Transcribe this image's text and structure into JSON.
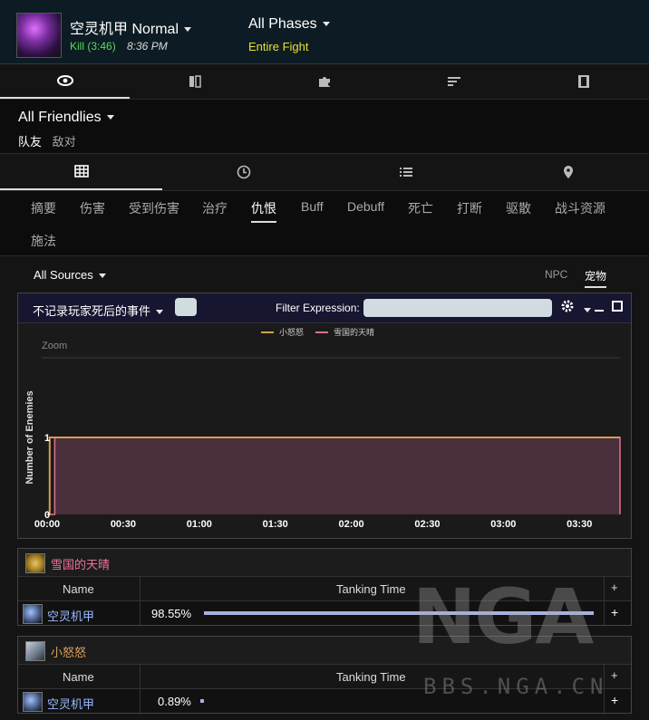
{
  "header": {
    "encounter": "空灵机甲 Normal",
    "kill_text": "Kill (3:46)",
    "time": "8:36 PM",
    "phase": "All Phases",
    "phase_sub": "Entire Fight"
  },
  "top_tabs": [
    {
      "name": "eye-icon"
    },
    {
      "name": "compare-icon"
    },
    {
      "name": "puzzle-icon"
    },
    {
      "name": "sort-icon"
    },
    {
      "name": "film-icon"
    }
  ],
  "friendlies": {
    "select": "All Friendlies",
    "links": [
      "队友",
      "敌对"
    ]
  },
  "sub_tabs": [
    {
      "name": "table-icon"
    },
    {
      "name": "clock-icon"
    },
    {
      "name": "list-icon"
    },
    {
      "name": "map-pin-icon"
    }
  ],
  "view_tabs": [
    "摘要",
    "伤害",
    "受到伤害",
    "治疗",
    "仇恨",
    "Buff",
    "Debuff",
    "死亡",
    "打断",
    "驱散",
    "战斗资源",
    "施法"
  ],
  "active_view_tab": "仇恨",
  "sources": {
    "select": "All Sources",
    "npc": "NPC",
    "pet": "宠物"
  },
  "chart_toolbar": {
    "death_filter": "不记录玩家死后的事件",
    "filter_label": "Filter Expression:"
  },
  "chart_data": {
    "type": "area",
    "ylabel": "Number of Enemies",
    "zoom_label": "Zoom",
    "x_ticks": [
      "00:00",
      "00:30",
      "01:00",
      "01:30",
      "02:00",
      "02:30",
      "03:00",
      "03:30"
    ],
    "y_ticks": [
      "0",
      "1"
    ],
    "ylim": [
      0,
      1
    ],
    "xlim_seconds": [
      0,
      226
    ],
    "series": [
      {
        "name": "小怒怒",
        "color": "#d4a050",
        "points": [
          [
            0,
            0
          ],
          [
            1,
            0
          ],
          [
            1,
            1
          ],
          [
            226,
            1
          ]
        ]
      },
      {
        "name": "雪国的天晴",
        "color": "#e07090",
        "points": [
          [
            0,
            0
          ],
          [
            3,
            0
          ],
          [
            3,
            1
          ],
          [
            226,
            1
          ],
          [
            226,
            0
          ]
        ]
      }
    ]
  },
  "tables": [
    {
      "title": "雪国的天晴",
      "title_color": "#f070a0",
      "icon_color": "#c9a23a",
      "col_name": "Name",
      "col_value": "Tanking Time",
      "plus": "+",
      "rows": [
        {
          "name": "空灵机甲",
          "percent": "98.55%",
          "fraction": 0.9855
        }
      ]
    },
    {
      "title": "小怒怒",
      "title_color": "#d8a060",
      "icon_color": "#8a9aa8",
      "col_name": "Name",
      "col_value": "Tanking Time",
      "plus": "+",
      "rows": [
        {
          "name": "空灵机甲",
          "percent": "0.89%",
          "fraction": 0.0089
        }
      ]
    }
  ],
  "watermark": {
    "big": "NGA",
    "small": "BBS.NGA.CN"
  }
}
